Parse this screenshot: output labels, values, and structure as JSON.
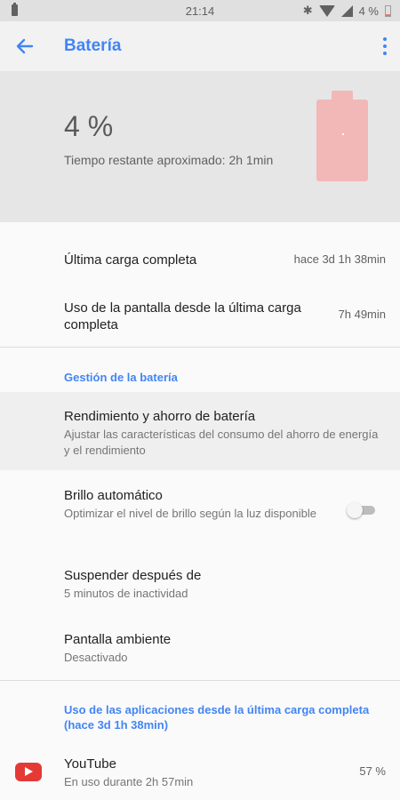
{
  "status": {
    "time": "21:14",
    "battery_pct": "4 %"
  },
  "appbar": {
    "title": "Batería"
  },
  "header": {
    "percent": "4 %",
    "remaining": "Tiempo restante aproximado: 2h 1min",
    "battery_level": 0.04
  },
  "usage": {
    "last_charge_label": "Última carga completa",
    "last_charge_value": "hace 3d 1h 38min",
    "screen_label": "Uso de la pantalla desde la última carga completa",
    "screen_value": "7h 49min"
  },
  "management": {
    "section_title": "Gestión de la batería",
    "performance_title": "Rendimiento y ahorro de batería",
    "performance_sub": "Ajustar las características del consumo del ahorro de energía y el rendimiento",
    "brightness_title": "Brillo automático",
    "brightness_sub": "Optimizar el nivel de brillo según la luz disponible",
    "brightness_on": false,
    "sleep_title": "Suspender después de",
    "sleep_sub": "5 minutos de inactividad",
    "ambient_title": "Pantalla ambiente",
    "ambient_sub": "Desactivado"
  },
  "apps": {
    "section_title": "Uso de las aplicaciones desde la última carga completa (hace 3d 1h 38min)",
    "items": [
      {
        "icon": "youtube-icon",
        "name": "YouTube",
        "detail": "En uso durante 2h 57min",
        "percent": "57 %"
      }
    ]
  }
}
